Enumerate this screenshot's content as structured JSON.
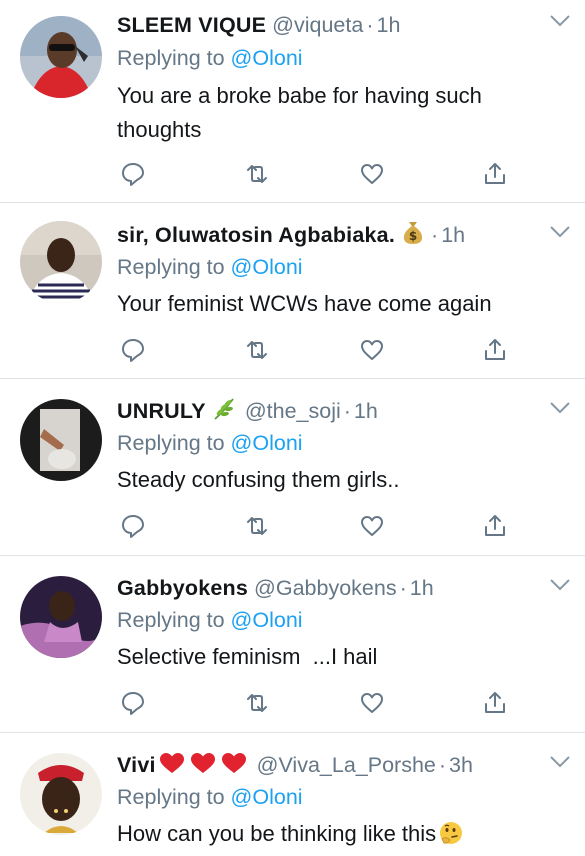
{
  "tweets": [
    {
      "name": "SLEEM VIQUE",
      "handle": "@viqueta",
      "dot": "·",
      "time": "1h",
      "replying_prefix": "Replying to ",
      "replying_to": "@Oloni",
      "text": "You are a broke babe for having such thoughts"
    },
    {
      "name": "sir, Oluwatosin Agbabiaka.",
      "handle": "",
      "dot": "·",
      "time": "1h",
      "badge_icon": "money-bag-icon",
      "replying_prefix": "Replying to ",
      "replying_to": "@Oloni",
      "text": "Your feminist WCWs have come again"
    },
    {
      "name": "UNRULY",
      "handle": "@the_soji",
      "dot": "·",
      "time": "1h",
      "badge_icon": "herb-icon",
      "replying_prefix": "Replying to ",
      "replying_to": "@Oloni",
      "text": "Steady confusing them girls.."
    },
    {
      "name": "Gabbyokens",
      "handle": "@Gabbyokens",
      "dot": "·",
      "time": "1h",
      "replying_prefix": "Replying to ",
      "replying_to": "@Oloni",
      "text": "Selective feminism  ...I hail"
    },
    {
      "name": "Vivi",
      "handle": "@Viva_La_Porshe",
      "dot": "·",
      "time": "3h",
      "badge_icon": "three-red-hearts-icon",
      "replying_prefix": "Replying to ",
      "replying_to": "@Oloni",
      "text": "How can you be thinking like this",
      "trailing_icon": "thinking-face-icon"
    }
  ],
  "icons": {
    "reply": "reply-icon",
    "retweet": "retweet-icon",
    "like": "like-icon",
    "share": "share-icon",
    "caret": "chevron-down-icon"
  },
  "colors": {
    "text": "#14171a",
    "muted": "#657786",
    "link": "#1da1f2",
    "divider": "#dfe3e6"
  }
}
